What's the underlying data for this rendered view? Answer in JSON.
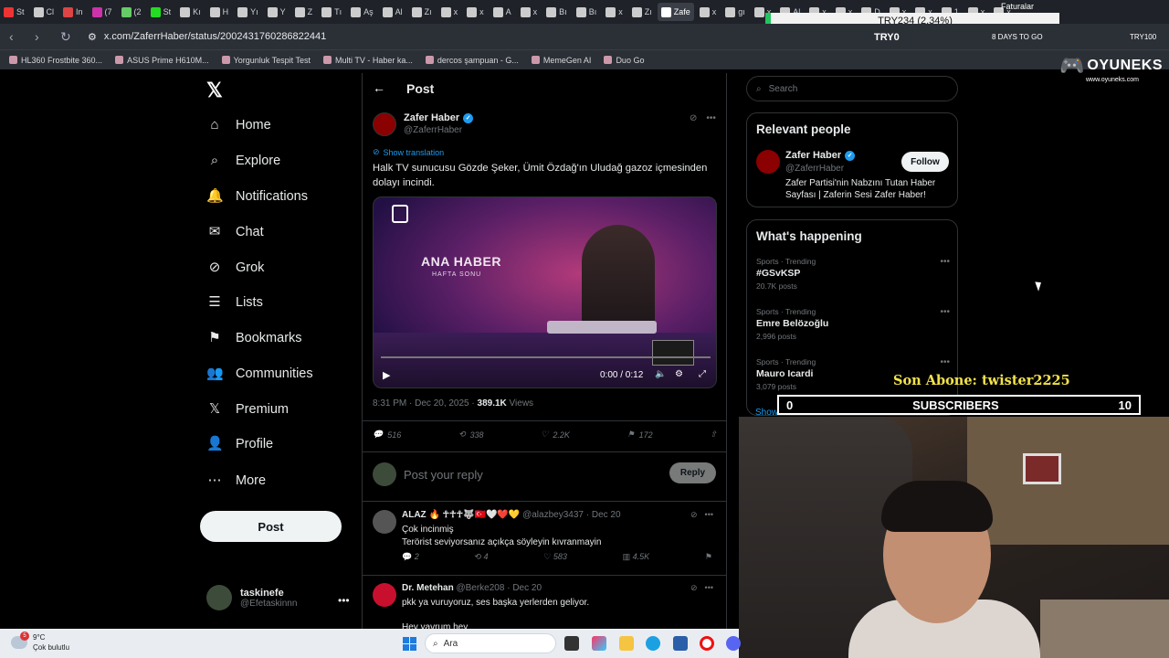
{
  "browser": {
    "tabs": [
      {
        "label": "St",
        "color": "#e33"
      },
      {
        "label": "Cl",
        "color": "#ccc"
      },
      {
        "label": "In",
        "color": "#d44"
      },
      {
        "label": "(7",
        "color": "#c3a"
      },
      {
        "label": "(2",
        "color": "#6c6"
      },
      {
        "label": "St",
        "color": "#2d2"
      },
      {
        "label": "Kı",
        "color": "#ccc"
      },
      {
        "label": "H",
        "color": "#ccc"
      },
      {
        "label": "Yı",
        "color": "#ccc"
      },
      {
        "label": "Y",
        "color": "#ccc"
      },
      {
        "label": "Z",
        "color": "#ccc"
      },
      {
        "label": "Tı",
        "color": "#ccc"
      },
      {
        "label": "Aş",
        "color": "#ccc"
      },
      {
        "label": "Al",
        "color": "#ccc"
      },
      {
        "label": "Zı",
        "color": "#ccc"
      },
      {
        "label": "x",
        "color": "#ccc"
      },
      {
        "label": "x",
        "color": "#ccc"
      },
      {
        "label": "A",
        "color": "#ccc"
      },
      {
        "label": "x",
        "color": "#ccc"
      },
      {
        "label": "Bı",
        "color": "#ccc"
      },
      {
        "label": "Bı",
        "color": "#ccc"
      },
      {
        "label": "x",
        "color": "#ccc"
      },
      {
        "label": "Zı",
        "color": "#ccc"
      },
      {
        "label": "Zafe",
        "color": "#fff",
        "active": true
      },
      {
        "label": "x",
        "color": "#ccc"
      },
      {
        "label": "gı",
        "color": "#ccc"
      },
      {
        "label": "x",
        "color": "#ccc"
      },
      {
        "label": "Al",
        "color": "#ccc"
      },
      {
        "label": "x",
        "color": "#ccc"
      },
      {
        "label": "x",
        "color": "#ccc"
      },
      {
        "label": "D",
        "color": "#ccc"
      },
      {
        "label": "x",
        "color": "#ccc"
      },
      {
        "label": "x",
        "color": "#ccc"
      },
      {
        "label": "1",
        "color": "#ccc"
      },
      {
        "label": "x",
        "color": "#ccc"
      },
      {
        "label": "x",
        "color": "#ccc"
      }
    ],
    "url": "x.com/ZaferrHaber/status/2002431760286822441",
    "bookmarks": [
      "HL360 Frostbite 360...",
      "ASUS Prime H610M...",
      "Yorgunluk Tespit Test",
      "Multi TV - Haber ka...",
      "dercos şampuan - G...",
      "MemeGen AI",
      "Duo Go"
    ]
  },
  "overlay": {
    "ticker": "TRY234 (2.34%)",
    "ticker_label": "TRY0",
    "faturalar": "Faturalar",
    "days": "8 DAYS TO GO",
    "try_right": "TRY100",
    "oyuneks": "OYUNEKS",
    "oyuneks_url": "www.oyuneks.com",
    "son_abone": "Son Abone: twister2225",
    "subs_left": "0",
    "subs_label": "SUBSCRIBERS",
    "subs_right": "10"
  },
  "sidebar": {
    "items": [
      {
        "label": "Home",
        "icon": "⌂"
      },
      {
        "label": "Explore",
        "icon": "⌕"
      },
      {
        "label": "Notifications",
        "icon": "🔔"
      },
      {
        "label": "Chat",
        "icon": "✉"
      },
      {
        "label": "Grok",
        "icon": "⊘"
      },
      {
        "label": "Lists",
        "icon": "☰"
      },
      {
        "label": "Bookmarks",
        "icon": "⚑"
      },
      {
        "label": "Communities",
        "icon": "👥"
      },
      {
        "label": "Premium",
        "icon": "𝕏"
      },
      {
        "label": "Profile",
        "icon": "👤"
      },
      {
        "label": "More",
        "icon": "⋯"
      }
    ],
    "post_label": "Post",
    "user_name": "taskinefe",
    "user_handle": "@Efetaskinnn"
  },
  "post": {
    "title": "Post",
    "author_name": "Zafer Haber",
    "author_handle": "@ZaferrHaber",
    "show_translation": "Show translation",
    "text": "Halk TV sunucusu Gözde Şeker, Ümit Özdağ'ın Uludağ gazoz içmesinden dolayı incindi.",
    "video_title": "ANA HABER",
    "video_subtitle": "HAFTA SONU",
    "video_time": "0:00 / 0:12",
    "timestamp": "8:31 PM · Dec 20, 2025 · ",
    "views": "389.1K",
    "views_label": " Views",
    "stats": {
      "replies": "516",
      "reposts": "338",
      "likes": "2.2K",
      "bookmarks": "172"
    },
    "reply_placeholder": "Post your reply",
    "reply_button": "Reply"
  },
  "replies": [
    {
      "name": "ALAZ 🔥 ☥☥☥🐺🇹🇷🤍❤️💛",
      "handle": "@alazbey3437 · Dec 20",
      "line1": "Çok incinmiş",
      "line2": "Terörist seviyorsanız açıkça söyleyin kıvranmayin",
      "replies": "2",
      "reposts": "4",
      "likes": "583",
      "views": "4.5K",
      "color": "#555"
    },
    {
      "name": "Dr. Metehan",
      "handle": "@Berke208 · Dec 20",
      "line1": "pkk ya vuruyoruz, ses başka yerlerden geliyor.",
      "line2": "Hey yavrum hey",
      "color": "#c8102e"
    }
  ],
  "right": {
    "search_placeholder": "Search",
    "relevant_title": "Relevant people",
    "rp_name": "Zafer Haber",
    "rp_handle": "@ZaferrHaber",
    "rp_bio": "Zafer Partisi'nin Nabzını Tutan Haber Sayfası | Zaferin Sesi Zafer Haber!",
    "follow": "Follow",
    "happening_title": "What's happening",
    "trends": [
      {
        "cat": "Sports · Trending",
        "name": "#GSvKSP",
        "posts": "20.7K posts"
      },
      {
        "cat": "Sports · Trending",
        "name": "Emre Belözoğlu",
        "posts": "2,996 posts"
      },
      {
        "cat": "Sports · Trending",
        "name": "Mauro Icardi",
        "posts": "3,079 posts"
      }
    ],
    "show_more": "Show more"
  },
  "taskbar": {
    "temp": "9°C",
    "weather": "Çok bulutlu",
    "weather_badge": "5",
    "search": "Ara"
  }
}
